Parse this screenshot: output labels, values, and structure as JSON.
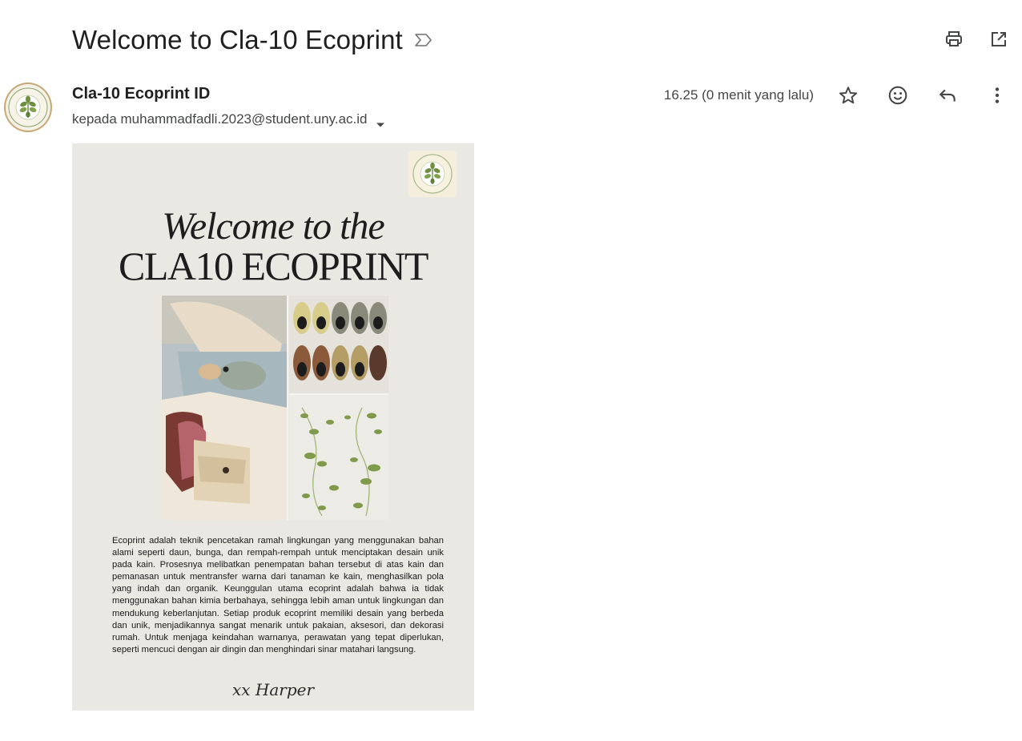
{
  "subject": "Welcome to Cla-10 Ecoprint",
  "sender": {
    "name": "Cla-10 Ecoprint ID",
    "recipient_line": "kepada muhammadfadli.2023@student.uny.ac.id",
    "time": "16.25 (0 menit yang lalu)"
  },
  "icons": {
    "importance": "importance-marker-icon",
    "print": "print-icon",
    "open_new_window": "open-in-new-window-icon",
    "star": "star-icon",
    "emoji": "emoji-icon",
    "reply": "reply-icon",
    "more": "more-vert-icon",
    "caret": "caret-down-icon"
  },
  "poster": {
    "headline": "Welcome to the",
    "brand": "CLA10 ECOPRINT",
    "body": "Ecoprint adalah teknik pencetakan ramah lingkungan yang menggunakan bahan alami seperti daun, bunga, dan rempah-rempah untuk menciptakan desain unik pada kain. Prosesnya melibatkan penempatan bahan tersebut di atas kain dan pemanasan untuk mentransfer warna dari tanaman ke kain, menghasilkan pola yang indah dan organik. Keunggulan utama ecoprint adalah bahwa ia tidak menggunakan bahan kimia berbahaya, sehingga lebih aman untuk lingkungan dan mendukung keberlanjutan. Setiap produk ecoprint memiliki desain yang berbeda dan unik, menjadikannya sangat menarik untuk pakaian, aksesori, dan dekorasi rumah. Untuk menjaga keindahan warnanya, perawatan yang tepat diperlukan, seperti mencuci dengan air dingin dan menghindari sinar matahari langsung.",
    "signature": "xx Harper"
  },
  "colors": {
    "text_primary": "#1f1f1f",
    "text_secondary": "#444746",
    "poster_bg": "#e9e8e3",
    "leaf_green": "#6e8f3f"
  }
}
